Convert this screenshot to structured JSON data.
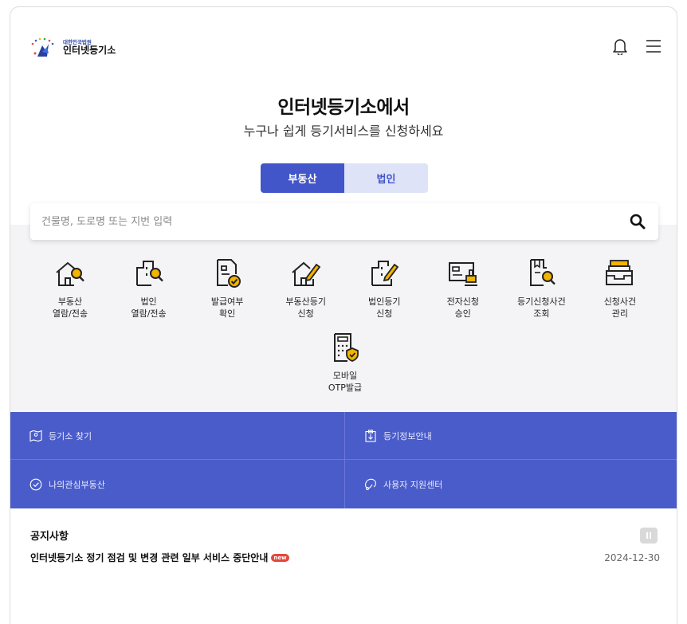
{
  "header": {
    "logo_sub": "대한민국법원",
    "logo_main": "인터넷등기소"
  },
  "hero": {
    "title": "인터넷등기소에서",
    "subtitle": "누구나 쉽게 등기서비스를 신청하세요"
  },
  "toggle": {
    "real_estate": "부동산",
    "corporation": "법인"
  },
  "search": {
    "placeholder": "건물명, 도로명 또는 지번 입력"
  },
  "services": [
    {
      "line1": "부동산",
      "line2": "열람/전송",
      "icon": "house-search-icon"
    },
    {
      "line1": "법인",
      "line2": "열람/전송",
      "icon": "building-search-icon"
    },
    {
      "line1": "발급여부",
      "line2": "확인",
      "icon": "document-check-icon"
    },
    {
      "line1": "부동산등기",
      "line2": "신청",
      "icon": "house-pen-icon"
    },
    {
      "line1": "법인등기",
      "line2": "신청",
      "icon": "building-pen-icon"
    },
    {
      "line1": "전자신청",
      "line2": "승인",
      "icon": "id-card-stamp-icon"
    },
    {
      "line1": "등기신청사건",
      "line2": "조회",
      "icon": "folder-search-icon"
    },
    {
      "line1": "신청사건",
      "line2": "관리",
      "icon": "tray-icon"
    },
    {
      "line1": "모바일",
      "line2": "OTP발급",
      "icon": "calculator-shield-icon"
    }
  ],
  "blue_menu": [
    {
      "label": "등기소 찾기",
      "icon": "map-pin-icon"
    },
    {
      "label": "등기정보안내",
      "icon": "clipboard-download-icon"
    },
    {
      "label": "나의관심부동산",
      "icon": "check-circle-icon"
    },
    {
      "label": "사용자 지원센터",
      "icon": "headset-icon"
    }
  ],
  "notice": {
    "title": "공지사항",
    "item_text": "인터넷등기소 정기 점검 및 변경 관련 일부 서비스 중단안내",
    "badge": "new",
    "date": "2024-12-30"
  },
  "colors": {
    "primary": "#4255c9",
    "menu_bg": "#4a5cc9",
    "accent": "#f3b400",
    "toggle_inactive": "#dfe3f7"
  }
}
